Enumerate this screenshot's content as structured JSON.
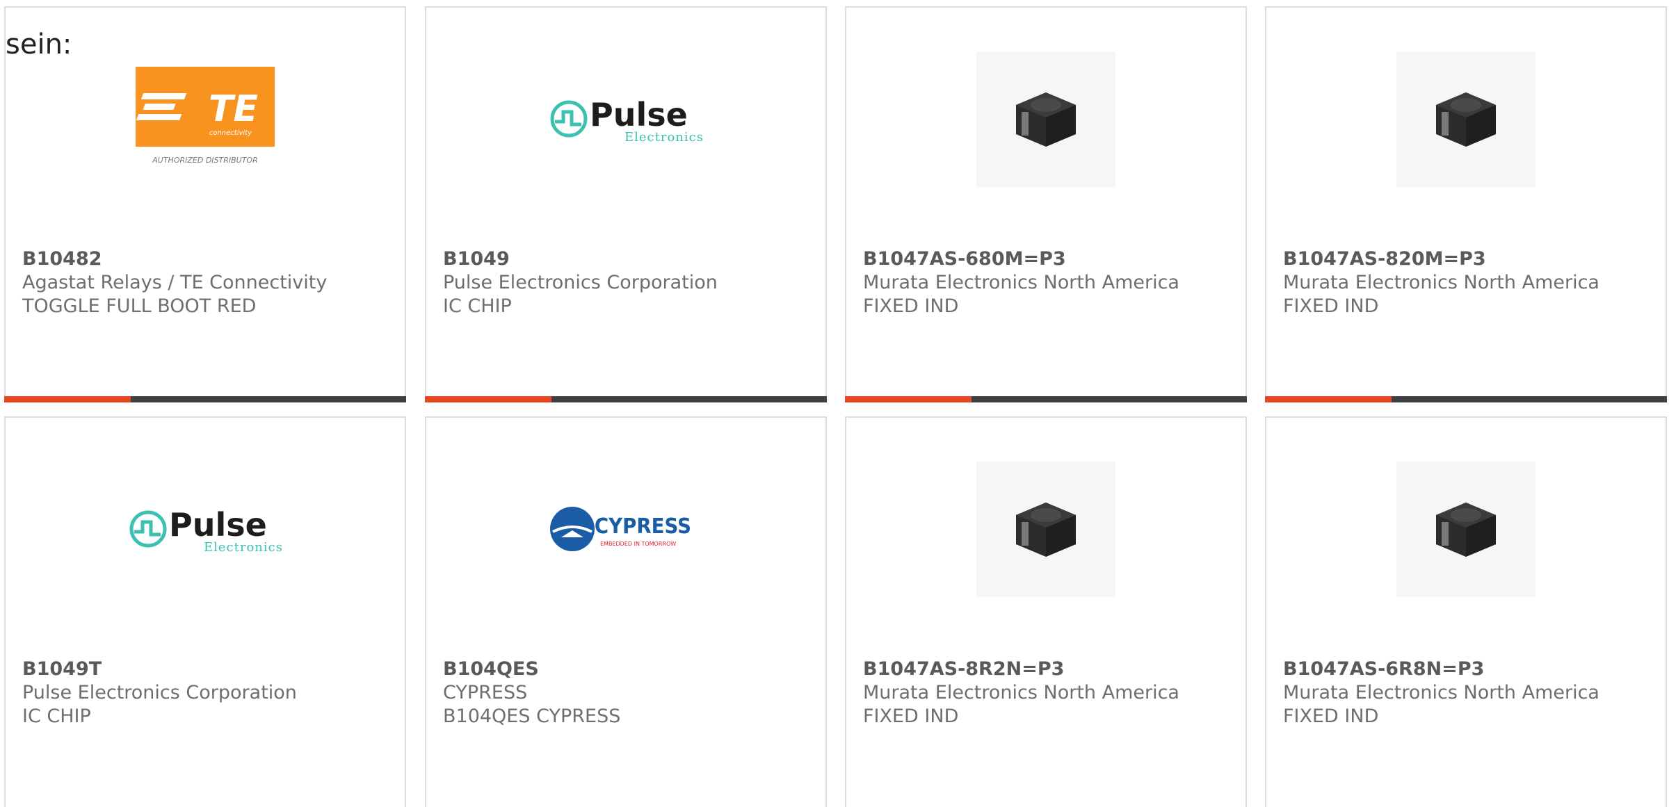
{
  "intro": {
    "text": "sein:"
  },
  "colors": {
    "accent": "#e8461e",
    "bar_dark": "#404040",
    "text_muted": "#6e6e6e",
    "te_orange": "#f7931e",
    "pulse_teal": "#3cc1b1",
    "cypress_blue": "#1a5da6",
    "cypress_red": "#e12127"
  },
  "logos": {
    "te": {
      "name": "te-connectivity-logo",
      "wordmark": "TE",
      "subline": "connectivity",
      "caption": "AUTHORIZED DISTRIBUTOR"
    },
    "pulse": {
      "name": "pulse-electronics-logo",
      "wordmark": "Pulse",
      "subline": "Electronics"
    },
    "cypress": {
      "name": "cypress-logo",
      "wordmark": "CYPRESS",
      "subline": "EMBEDDED IN TOMORROW"
    },
    "inductor": {
      "name": "inductor-photo"
    }
  },
  "products": [
    {
      "part_number": "B10482",
      "manufacturer": "Agastat Relays / TE Connectivity",
      "description": "TOGGLE FULL BOOT RED",
      "image": "te"
    },
    {
      "part_number": "B1049",
      "manufacturer": "Pulse Electronics Corporation",
      "description": "IC CHIP",
      "image": "pulse"
    },
    {
      "part_number": "B1047AS-680M=P3",
      "manufacturer": "Murata Electronics North America",
      "description": "FIXED IND",
      "image": "inductor"
    },
    {
      "part_number": "B1047AS-820M=P3",
      "manufacturer": "Murata Electronics North America",
      "description": "FIXED IND",
      "image": "inductor"
    },
    {
      "part_number": "B1049T",
      "manufacturer": "Pulse Electronics Corporation",
      "description": "IC CHIP",
      "image": "pulse"
    },
    {
      "part_number": "B104QES",
      "manufacturer": "CYPRESS",
      "description": "B104QES CYPRESS",
      "image": "cypress"
    },
    {
      "part_number": "B1047AS-8R2N=P3",
      "manufacturer": "Murata Electronics North America",
      "description": "FIXED IND",
      "image": "inductor"
    },
    {
      "part_number": "B1047AS-6R8N=P3",
      "manufacturer": "Murata Electronics North America",
      "description": "FIXED IND",
      "image": "inductor"
    }
  ]
}
